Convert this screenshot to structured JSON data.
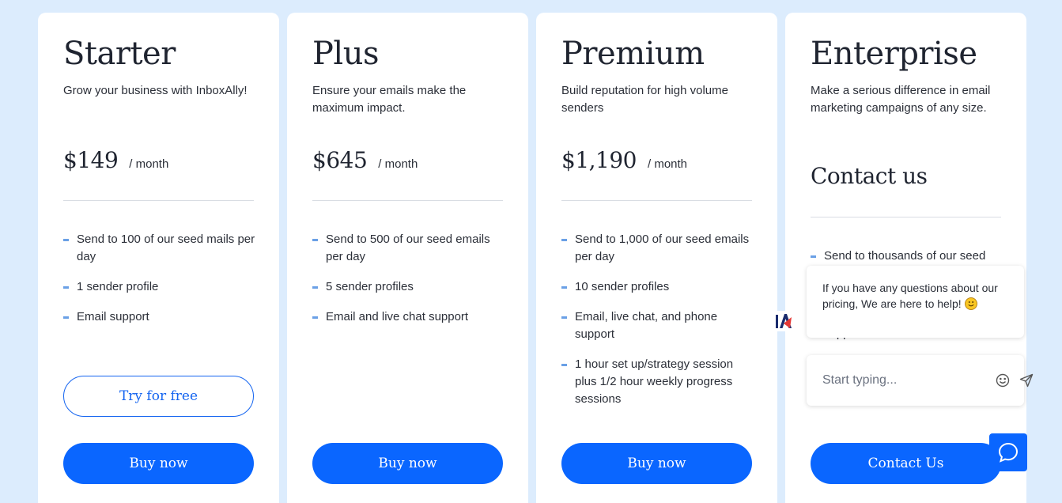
{
  "plans": [
    {
      "title": "Starter",
      "description": "Grow your business with InboxAlly!",
      "price": "$149",
      "period": "/ month",
      "features": [
        "Send to 100 of our seed mails per day",
        "1 sender profile",
        "Email support"
      ],
      "secondary_button": "Try for free",
      "primary_button": "Buy now"
    },
    {
      "title": "Plus",
      "description": "Ensure your emails make the maximum impact.",
      "price": "$645",
      "period": "/ month",
      "features": [
        "Send to 500 of our seed emails per day",
        "5 sender profiles",
        "Email and live chat support"
      ],
      "primary_button": "Buy now"
    },
    {
      "title": "Premium",
      "description": "Build reputation for high volume senders",
      "price": "$1,190",
      "period": "/ month",
      "features": [
        "Send to 1,000 of our seed emails per day",
        "10 sender profiles",
        "Email, live chat, and phone support",
        "1 hour set up/strategy session plus 1/2 hour weekly progress sessions"
      ],
      "primary_button": "Buy now"
    },
    {
      "title": "Enterprise",
      "description": "Make a serious difference in email marketing campaigns of any size.",
      "contact_heading": "Contact us",
      "features": [
        "Send to thousands of our seed",
        "support"
      ],
      "primary_button": "Contact Us"
    }
  ],
  "chat": {
    "message": "If you have any questions about our pricing, We are here to help!",
    "input_placeholder": "Start typing...",
    "logo_text": "IA"
  },
  "colors": {
    "background": "#dcecfd",
    "primary": "#0a66ff",
    "bullet": "#6aa0e6"
  }
}
